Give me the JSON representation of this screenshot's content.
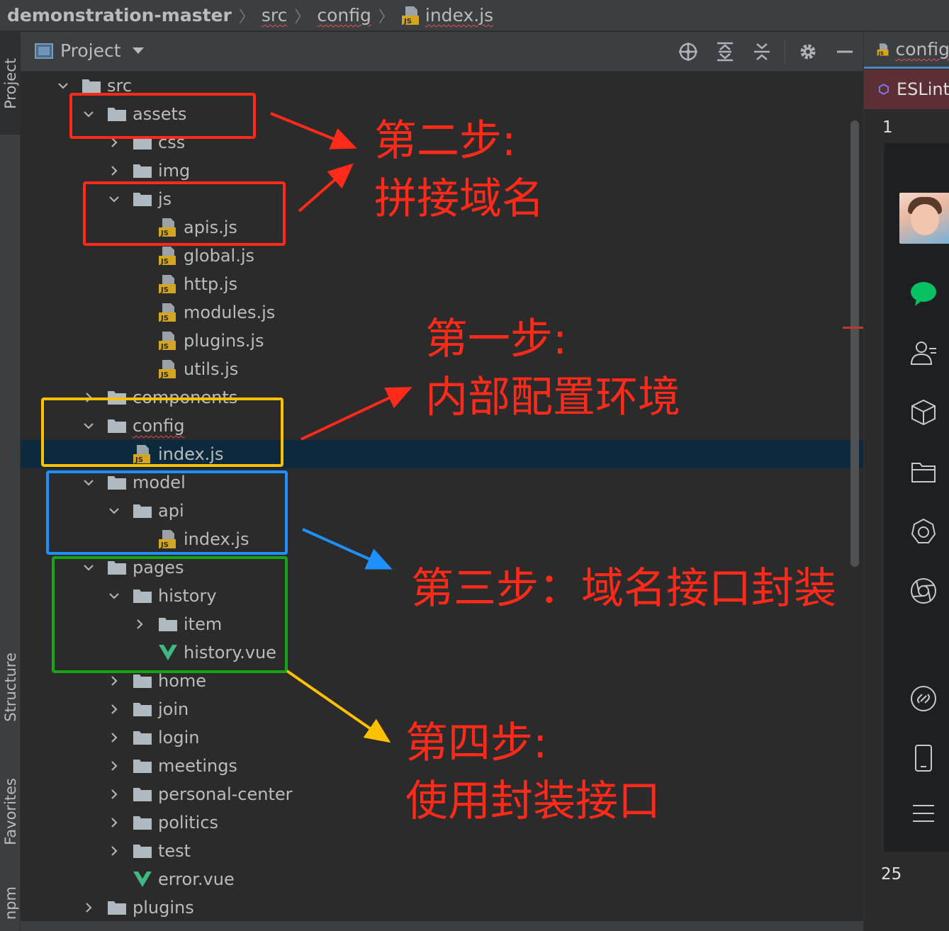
{
  "breadcrumb": {
    "items": [
      "demonstration-master",
      "src",
      "config",
      "index.js"
    ]
  },
  "left_stripe": {
    "tabs": [
      "Project",
      "Structure",
      "Favorites",
      "npm"
    ]
  },
  "panel": {
    "title": "Project",
    "tool_icons": [
      "locate-icon",
      "expand-all-icon",
      "collapse-all-icon",
      "gear-icon",
      "minimize-icon"
    ]
  },
  "tree": [
    {
      "label": "src",
      "type": "folder",
      "depth": 0,
      "expanded": true
    },
    {
      "label": "assets",
      "type": "folder",
      "depth": 1,
      "expanded": true
    },
    {
      "label": "css",
      "type": "folder",
      "depth": 2,
      "expanded": false
    },
    {
      "label": "img",
      "type": "folder",
      "depth": 2,
      "expanded": false
    },
    {
      "label": "js",
      "type": "folder",
      "depth": 2,
      "expanded": true
    },
    {
      "label": "apis.js",
      "type": "js",
      "depth": 3
    },
    {
      "label": "global.js",
      "type": "js",
      "depth": 3
    },
    {
      "label": "http.js",
      "type": "js",
      "depth": 3
    },
    {
      "label": "modules.js",
      "type": "js",
      "depth": 3
    },
    {
      "label": "plugins.js",
      "type": "js",
      "depth": 3
    },
    {
      "label": "utils.js",
      "type": "js",
      "depth": 3
    },
    {
      "label": "components",
      "type": "folder",
      "depth": 1,
      "expanded": false
    },
    {
      "label": "config",
      "type": "folder",
      "depth": 1,
      "expanded": true,
      "squiggle": true
    },
    {
      "label": "index.js",
      "type": "js",
      "depth": 2,
      "selected": true
    },
    {
      "label": "model",
      "type": "folder",
      "depth": 1,
      "expanded": true
    },
    {
      "label": "api",
      "type": "folder",
      "depth": 2,
      "expanded": true
    },
    {
      "label": "index.js",
      "type": "js",
      "depth": 3
    },
    {
      "label": "pages",
      "type": "folder",
      "depth": 1,
      "expanded": true
    },
    {
      "label": "history",
      "type": "folder",
      "depth": 2,
      "expanded": true
    },
    {
      "label": "item",
      "type": "folder",
      "depth": 3,
      "expanded": false
    },
    {
      "label": "history.vue",
      "type": "vue",
      "depth": 3
    },
    {
      "label": "home",
      "type": "folder",
      "depth": 2,
      "expanded": false
    },
    {
      "label": "join",
      "type": "folder",
      "depth": 2,
      "expanded": false
    },
    {
      "label": "login",
      "type": "folder",
      "depth": 2,
      "expanded": false
    },
    {
      "label": "meetings",
      "type": "folder",
      "depth": 2,
      "expanded": false
    },
    {
      "label": "personal-center",
      "type": "folder",
      "depth": 2,
      "expanded": false
    },
    {
      "label": "politics",
      "type": "folder",
      "depth": 2,
      "expanded": false
    },
    {
      "label": "test",
      "type": "folder",
      "depth": 2,
      "expanded": false
    },
    {
      "label": "error.vue",
      "type": "vue",
      "depth": 2
    },
    {
      "label": "plugins",
      "type": "folder",
      "depth": 1,
      "expanded": false
    }
  ],
  "editor": {
    "tab_label": "config",
    "eslint_label": "ESLint",
    "line_first": "1",
    "line_last": "25",
    "side_icons": [
      "chat-bubble-icon",
      "contacts-icon",
      "cube-icon",
      "folder-icon",
      "aperture-icon",
      "camera-aperture-icon",
      "link-icon",
      "phone-icon",
      "menu-icon"
    ]
  },
  "annotations": {
    "step2_line1": "第二步:",
    "step2_line2": "拼接域名",
    "step1_line1": "第一步:",
    "step1_line2": "内部配置环境",
    "step3": "第三步：域名接口封装",
    "step4_line1": "第四步:",
    "step4_line2": "使用封装接口"
  },
  "colors": {
    "red": "#ff2a1a",
    "yellow": "#ffc000",
    "blue": "#1e90ff",
    "green": "#19a319",
    "selected_row": "#0d293e",
    "folder": "#aeb9c0",
    "js_badge": "#d6a520",
    "vue_green": "#41b883"
  }
}
